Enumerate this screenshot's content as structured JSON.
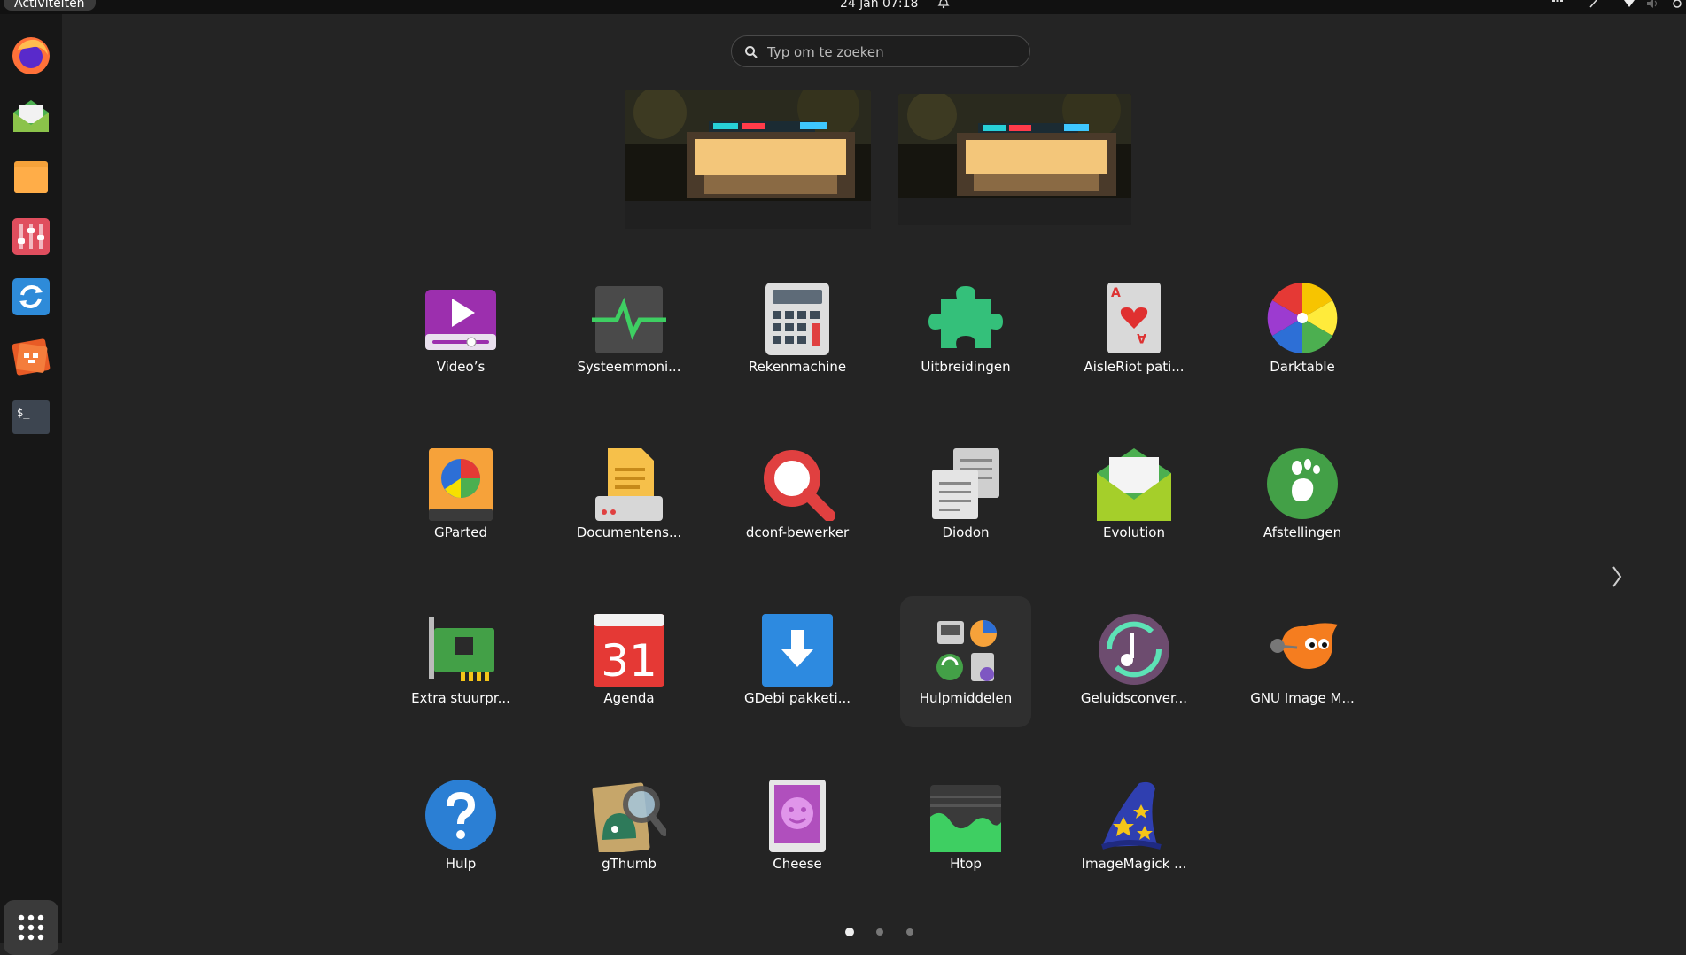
{
  "topbar": {
    "activities": "Activiteiten",
    "clock": "24 jan  07:18"
  },
  "search": {
    "placeholder": "Typ om te zoeken"
  },
  "dock": {
    "items": [
      {
        "name": "Firefox",
        "icon": "firefox-icon"
      },
      {
        "name": "Mail",
        "icon": "mail-icon"
      },
      {
        "name": "Bestanden",
        "icon": "folder-icon"
      },
      {
        "name": "Mixer",
        "icon": "mixer-icon"
      },
      {
        "name": "Synchronisatie",
        "icon": "sync-icon"
      },
      {
        "name": "Software",
        "icon": "software-icon"
      },
      {
        "name": "Terminal",
        "icon": "terminal-icon"
      }
    ]
  },
  "apps": [
    {
      "label": "Video’s"
    },
    {
      "label": "Systeemmoni..."
    },
    {
      "label": "Rekenmachine"
    },
    {
      "label": "Uitbreidingen"
    },
    {
      "label": "AisleRiot pati..."
    },
    {
      "label": "Darktable"
    },
    {
      "label": "GParted"
    },
    {
      "label": "Documentens..."
    },
    {
      "label": "dconf-bewerker"
    },
    {
      "label": "Diodon"
    },
    {
      "label": "Evolution"
    },
    {
      "label": "Afstellingen"
    },
    {
      "label": "Extra stuurpr..."
    },
    {
      "label": "Agenda",
      "icon_text": "31"
    },
    {
      "label": "GDebi pakketi..."
    },
    {
      "label": "Hulpmiddelen"
    },
    {
      "label": "Geluidsconver..."
    },
    {
      "label": "GNU Image M..."
    },
    {
      "label": "Hulp"
    },
    {
      "label": "gThumb"
    },
    {
      "label": "Cheese"
    },
    {
      "label": "Htop"
    },
    {
      "label": "ImageMagick ..."
    }
  ],
  "pagination": {
    "pages": 3,
    "current": 1
  }
}
